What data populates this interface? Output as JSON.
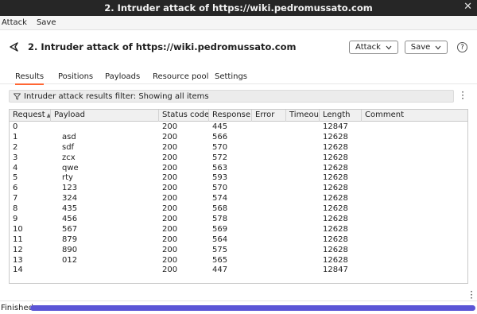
{
  "window": {
    "title": "2. Intruder attack of https://wiki.pedromussato.com",
    "close_glyph": "✕"
  },
  "menubar": {
    "items": [
      "Attack",
      "Save"
    ]
  },
  "header": {
    "title": "2. Intruder attack of https://wiki.pedromussato.com",
    "attack_button": "Attack",
    "save_button": "Save",
    "help_glyph": "?"
  },
  "tabs": [
    {
      "label": "Results",
      "active": true
    },
    {
      "label": "Positions",
      "active": false
    },
    {
      "label": "Payloads",
      "active": false
    },
    {
      "label": "Resource pool",
      "active": false
    },
    {
      "label": "Settings",
      "active": false
    }
  ],
  "filter": {
    "text": "Intruder attack results filter: Showing all items"
  },
  "table": {
    "columns": [
      "Request",
      "Payload",
      "Status code",
      "Response ...",
      "Error",
      "Timeout",
      "Length",
      "Comment"
    ],
    "sort_glyph": "▲",
    "rows": [
      [
        "0",
        "",
        "200",
        "445",
        "",
        "",
        "12847",
        ""
      ],
      [
        "1",
        "asd",
        "200",
        "566",
        "",
        "",
        "12628",
        ""
      ],
      [
        "2",
        "sdf",
        "200",
        "570",
        "",
        "",
        "12628",
        ""
      ],
      [
        "3",
        "zcx",
        "200",
        "572",
        "",
        "",
        "12628",
        ""
      ],
      [
        "4",
        "qwe",
        "200",
        "563",
        "",
        "",
        "12628",
        ""
      ],
      [
        "5",
        "rty",
        "200",
        "593",
        "",
        "",
        "12628",
        ""
      ],
      [
        "6",
        "123",
        "200",
        "570",
        "",
        "",
        "12628",
        ""
      ],
      [
        "7",
        "324",
        "200",
        "574",
        "",
        "",
        "12628",
        ""
      ],
      [
        "8",
        "435",
        "200",
        "568",
        "",
        "",
        "12628",
        ""
      ],
      [
        "9",
        "456",
        "200",
        "578",
        "",
        "",
        "12628",
        ""
      ],
      [
        "10",
        "567",
        "200",
        "569",
        "",
        "",
        "12628",
        ""
      ],
      [
        "11",
        "879",
        "200",
        "564",
        "",
        "",
        "12628",
        ""
      ],
      [
        "12",
        "890",
        "200",
        "575",
        "",
        "",
        "12628",
        ""
      ],
      [
        "13",
        "012",
        "200",
        "565",
        "",
        "",
        "12628",
        ""
      ],
      [
        "14",
        "",
        "200",
        "447",
        "",
        "",
        "12847",
        ""
      ]
    ]
  },
  "status": {
    "label": "Finished",
    "progress": 1.0,
    "progress_color": "#5b55d6"
  },
  "colors": {
    "tab_accent": "#ff6633",
    "titlebar": "#262626"
  }
}
